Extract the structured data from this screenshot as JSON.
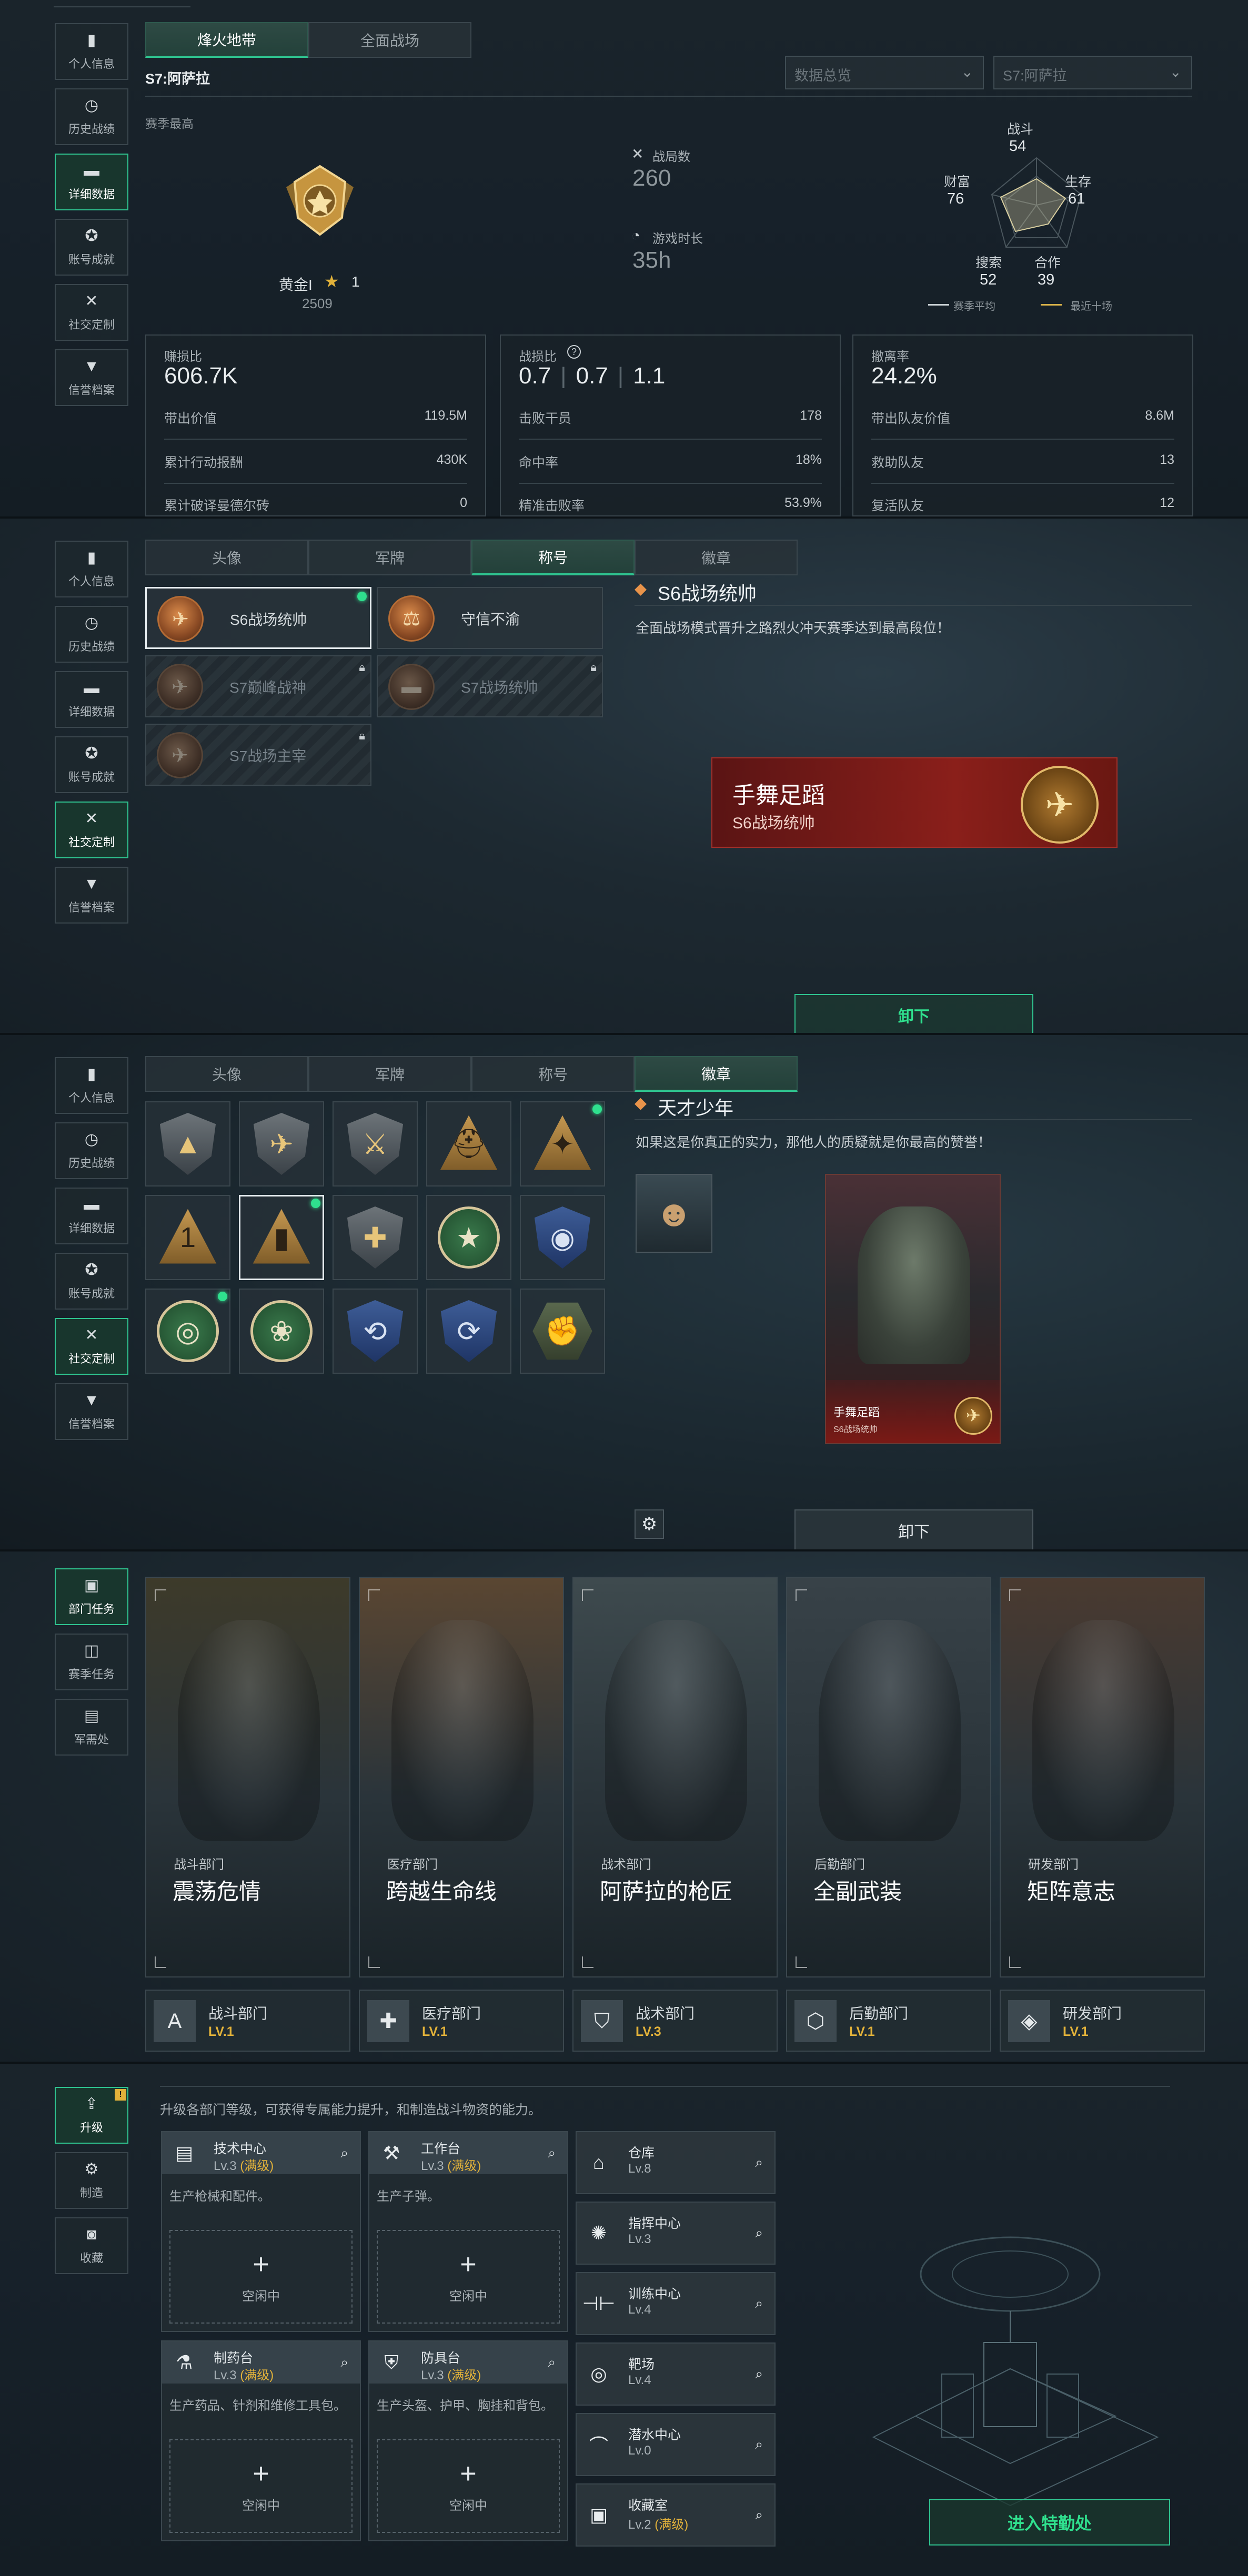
{
  "panel1": {
    "nav": [
      {
        "label": "个人信息",
        "icon": "bar-chart-icon"
      },
      {
        "label": "历史战绩",
        "icon": "history-icon"
      },
      {
        "label": "详细数据",
        "icon": "folder-icon",
        "active": true
      },
      {
        "label": "账号成就",
        "icon": "medal-icon"
      },
      {
        "label": "社交定制",
        "icon": "tools-icon"
      },
      {
        "label": "信誉档案",
        "icon": "shield-icon"
      }
    ],
    "tabs": [
      "烽火地带",
      "全面战场"
    ],
    "season_label": "S7:阿萨拉",
    "filter1": "数据总览",
    "filter2": "S7:阿萨拉",
    "best_label": "赛季最高",
    "rank_name": "黄金I",
    "rank_stars": "1",
    "rank_score": "2509",
    "matches_label": "战局数",
    "matches_value": "260",
    "time_label": "游戏时长",
    "time_value": "35h",
    "radar": {
      "labels": {
        "combat": "战斗",
        "survival": "生存",
        "teamwork": "合作",
        "search": "搜索",
        "wealth": "财富"
      },
      "values": {
        "combat": "54",
        "survival": "61",
        "teamwork": "39",
        "search": "52",
        "wealth": "76"
      },
      "legend_avg": "赛季平均",
      "legend_recent": "最近十场"
    },
    "box1": {
      "title": "赚损比",
      "value": "606.7K",
      "rows": [
        [
          "带出价值",
          "119.5M"
        ],
        [
          "累计行动报酬",
          "430K"
        ],
        [
          "累计破译曼德尔砖",
          "0"
        ]
      ]
    },
    "box2": {
      "title": "战损比",
      "v1": "0.7",
      "v2": "0.7",
      "v3": "1.1",
      "rows": [
        [
          "击败干员",
          "178"
        ],
        [
          "命中率",
          "18%"
        ],
        [
          "精准击败率",
          "53.9%"
        ]
      ]
    },
    "box3": {
      "title": "撤离率",
      "value": "24.2%",
      "rows": [
        [
          "带出队友价值",
          "8.6M"
        ],
        [
          "救助队友",
          "13"
        ],
        [
          "复活队友",
          "12"
        ]
      ]
    }
  },
  "panel2": {
    "tabs": [
      "头像",
      "军牌",
      "称号",
      "徽章"
    ],
    "titles": [
      {
        "name": "S6战场统帅",
        "selected": true,
        "dot": true,
        "locked": false
      },
      {
        "name": "守信不渝",
        "selected": false,
        "dot": false,
        "locked": false
      },
      {
        "name": "S7巅峰战神",
        "selected": false,
        "dot": false,
        "locked": true
      },
      {
        "name": "S7战场统帅",
        "selected": false,
        "dot": false,
        "locked": true
      },
      {
        "name": "S7战场主宰",
        "selected": false,
        "dot": false,
        "locked": true
      }
    ],
    "detail_title": "S6战场统帅",
    "detail_desc": "全面战场模式晋升之路烈火冲天赛季达到最高段位！",
    "banner_name": "手舞足蹈",
    "banner_title": "S6战场统帅",
    "button": "卸下"
  },
  "panel3": {
    "tabs": [
      "头像",
      "军牌",
      "称号",
      "徽章"
    ],
    "detail_title": "天才少年",
    "detail_desc": "如果这是你真正的实力，那他人的质疑就是你最高的赞誉！",
    "card_name": "手舞足蹈",
    "card_title": "S6战场统帅",
    "button": "卸下",
    "badges": [
      {
        "type": "b-shield",
        "glyph": "▲",
        "sel": false,
        "dot": false
      },
      {
        "type": "b-shield",
        "glyph": "✈",
        "sel": false,
        "dot": false
      },
      {
        "type": "b-shield",
        "glyph": "⚔",
        "sel": false,
        "dot": false
      },
      {
        "type": "b-tri",
        "glyph": "⛑",
        "sel": false,
        "dot": false
      },
      {
        "type": "b-tri",
        "glyph": "✦",
        "sel": false,
        "dot": true
      },
      {
        "type": "b-tri",
        "glyph": "1",
        "sel": false,
        "dot": false
      },
      {
        "type": "b-tri",
        "glyph": "▮",
        "sel": true,
        "dot": true
      },
      {
        "type": "b-shield",
        "glyph": "✚",
        "sel": false,
        "dot": false
      },
      {
        "type": "b-round",
        "glyph": "★",
        "sel": false,
        "dot": false
      },
      {
        "type": "b-blue",
        "glyph": "◉",
        "sel": false,
        "dot": false
      },
      {
        "type": "b-round",
        "glyph": "◎",
        "sel": false,
        "dot": true
      },
      {
        "type": "b-round",
        "glyph": "❀",
        "sel": false,
        "dot": false
      },
      {
        "type": "b-blue",
        "glyph": "⟲",
        "sel": false,
        "dot": false
      },
      {
        "type": "b-blue",
        "glyph": "⟳",
        "sel": false,
        "dot": false
      },
      {
        "type": "b-hex",
        "glyph": "✊",
        "sel": false,
        "dot": false
      }
    ]
  },
  "panel4": {
    "nav": [
      {
        "label": "部门任务",
        "icon": "clipboard-icon",
        "active": true
      },
      {
        "label": "赛季任务",
        "icon": "briefcase-icon"
      },
      {
        "label": "军需处",
        "icon": "box-icon"
      }
    ],
    "departments": [
      {
        "sub": "战斗部门",
        "title": "震荡危情",
        "name": "战斗部门",
        "level": "LV.1",
        "icon": "A",
        "bg": "#3d3a2a"
      },
      {
        "sub": "医疗部门",
        "title": "跨越生命线",
        "name": "医疗部门",
        "level": "LV.1",
        "icon": "✚",
        "bg": "#5a4632"
      },
      {
        "sub": "战术部门",
        "title": "阿萨拉的枪匠",
        "name": "战术部门",
        "level": "LV.3",
        "icon": "⛉",
        "bg": "#3e4a4e"
      },
      {
        "sub": "后勤部门",
        "title": "全副武装",
        "name": "后勤部门",
        "level": "LV.1",
        "icon": "⬡",
        "bg": "#384248"
      },
      {
        "sub": "研发部门",
        "title": "矩阵意志",
        "name": "研发部门",
        "level": "LV.1",
        "icon": "◈",
        "bg": "#4a3a30"
      }
    ]
  },
  "panel5": {
    "nav": [
      {
        "label": "升级",
        "icon": "upgrade-icon",
        "active": true,
        "badge": "!"
      },
      {
        "label": "制造",
        "icon": "gear-icon"
      },
      {
        "label": "收藏",
        "icon": "collection-icon"
      }
    ],
    "intro": "升级各部门等级，可获得专属能力提升，和制造战斗物资的能力。",
    "facilities": [
      {
        "name": "技术中心",
        "level": "Lv.3",
        "max": "(满级)",
        "desc": "生产枪械和配件。",
        "idle": "空闲中",
        "icon": "▤"
      },
      {
        "name": "工作台",
        "level": "Lv.3",
        "max": "(满级)",
        "desc": "生产子弹。",
        "idle": "空闲中",
        "icon": "⚒"
      },
      {
        "name": "制药台",
        "level": "Lv.3",
        "max": "(满级)",
        "desc": "生产药品、针剂和维修工具包。",
        "idle": "空闲中",
        "icon": "⚗"
      },
      {
        "name": "防具台",
        "level": "Lv.3",
        "max": "(满级)",
        "desc": "生产头盔、护甲、胸挂和背包。",
        "idle": "空闲中",
        "icon": "⛨"
      }
    ],
    "rooms": [
      {
        "name": "仓库",
        "level": "Lv.8",
        "max": "",
        "icon": "⌂"
      },
      {
        "name": "指挥中心",
        "level": "Lv.3",
        "max": "",
        "icon": "✺"
      },
      {
        "name": "训练中心",
        "level": "Lv.4",
        "max": "",
        "icon": "⊣⊢"
      },
      {
        "name": "靶场",
        "level": "Lv.4",
        "max": "",
        "icon": "◎"
      },
      {
        "name": "潜水中心",
        "level": "Lv.0",
        "max": "",
        "icon": "⌒"
      },
      {
        "name": "收藏室",
        "level": "Lv.2",
        "max": "(满级)",
        "icon": "▣"
      }
    ],
    "enter_button": "进入特勤处"
  },
  "colors": {
    "accent": "#2fc38f",
    "gold": "#e2b23a",
    "bg": "#141c22"
  }
}
